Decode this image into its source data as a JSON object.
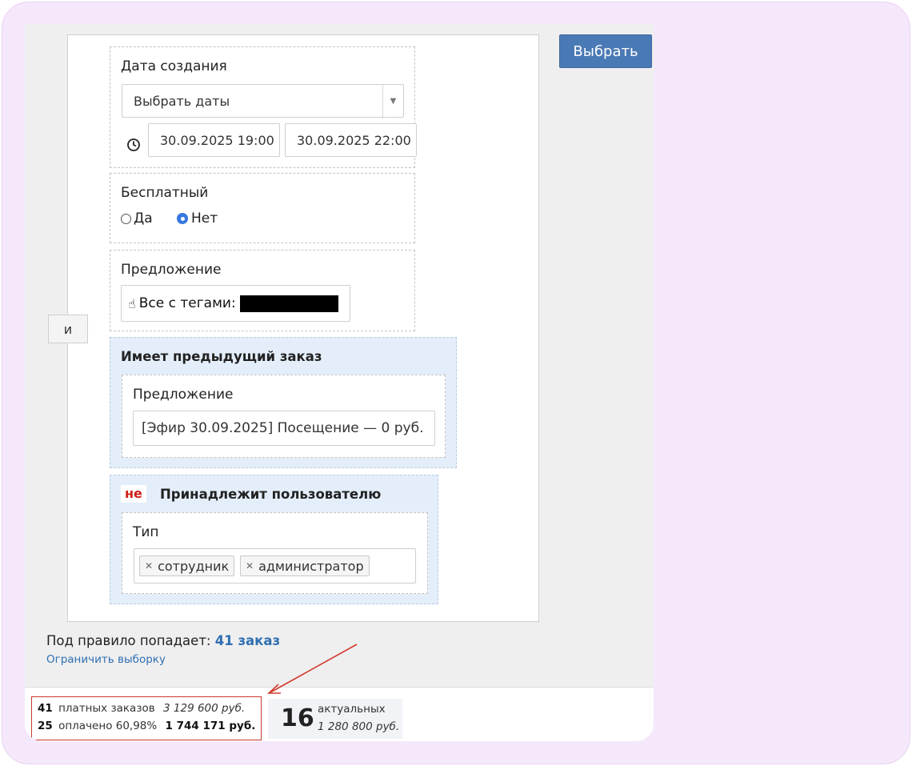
{
  "filters": {
    "created": {
      "label": "Дата создания",
      "select_value": "Выбрать даты",
      "date_from": "30.09.2025 19:00",
      "date_to": "30.09.2025 22:00"
    },
    "free": {
      "label": "Бесплатный",
      "option_yes": "Да",
      "option_no": "Нет",
      "selected": "Нет"
    },
    "offer": {
      "label": "Предложение",
      "value": "Все с тегами:"
    },
    "previous_order": {
      "title": "Имеет предыдущий заказ",
      "offer_label": "Предложение",
      "offer_value": "[Эфир 30.09.2025] Посещение — 0 руб."
    },
    "belongs_user": {
      "negation": "не",
      "title": "Принадлежит пользователю",
      "type_label": "Тип",
      "tags": [
        "сотрудник",
        "администратор"
      ]
    }
  },
  "buttons": {
    "choose": "Выбрать",
    "and": "и"
  },
  "rule": {
    "prefix": "Под правило попадает:",
    "count_link": "41 заказ",
    "limit_link": "Ограничить выборку"
  },
  "stats": {
    "paid_count": "41",
    "paid_label": "платных заказов",
    "paid_sum": "3 129 600 руб.",
    "payed_count": "25",
    "payed_label": "оплачено 60,98%",
    "payed_sum": "1 744 171 руб.",
    "actual_count": "16",
    "actual_label": "актуальных",
    "actual_sum": "1 280 800 руб."
  },
  "colors": {
    "accent": "#4a7ab5",
    "link": "#2f6fb2",
    "negation": "#d0201a",
    "highlight_border": "#c83a2e",
    "arrow": "#d23a2e",
    "frame_bg": "#f5e8fb"
  },
  "icons": {
    "clock": "clock-icon",
    "hand": "hand-pointer-icon",
    "dropdown": "caret-down-icon"
  }
}
